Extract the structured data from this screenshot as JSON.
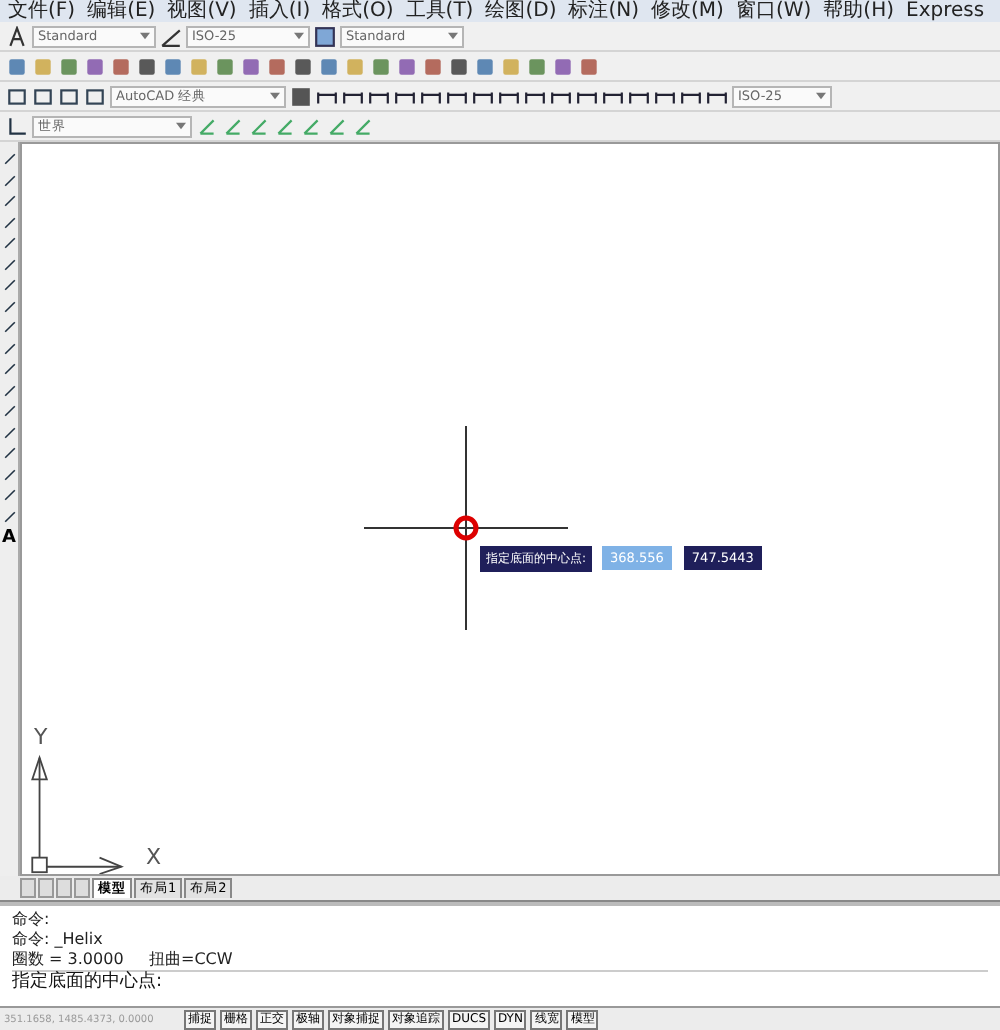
{
  "menu_bar": [
    "文件(F)",
    "编辑(E)",
    "视图(V)",
    "插入(I)",
    "格式(O)",
    "工具(T)",
    "绘图(D)",
    "标注(N)",
    "修改(M)",
    "窗口(W)",
    "帮助(H)",
    "Express"
  ],
  "styles_toolbar": {
    "text_style": "Standard",
    "dim_style": "ISO-25",
    "table_style": "Standard"
  },
  "workspace_toolbar": {
    "workspace": "AutoCAD 经典",
    "dim_style": "ISO-25"
  },
  "ucs_toolbar": {
    "ucs": "世界"
  },
  "left_toolbar": {
    "text_icon": "A"
  },
  "canvas": {
    "prompt": "指定底面的中心点:",
    "x_value": "368.556",
    "y_value": "747.5443",
    "axis_y": "Y",
    "axis_x": "X"
  },
  "layout_tabs": [
    {
      "label": "模型",
      "selected": true
    },
    {
      "label": "布局1",
      "selected": false
    },
    {
      "label": "布局2",
      "selected": false
    }
  ],
  "command_history": [
    "命令:",
    "命令: _Helix",
    "圈数 = 3.0000     扭曲=CCW"
  ],
  "command_prompt": "指定底面的中心点:",
  "status_bar": {
    "coordinates": "351.1658, 1485.4373, 0.0000",
    "buttons": [
      "捕捉",
      "栅格",
      "正交",
      "极轴",
      "对象捕捉",
      "对象追踪",
      "DUCS",
      "DYN",
      "线宽",
      "模型"
    ]
  }
}
